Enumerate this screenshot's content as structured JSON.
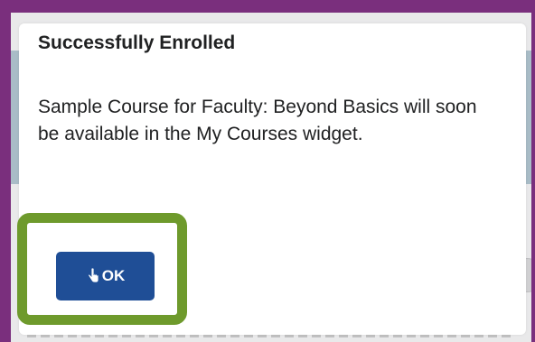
{
  "dialog": {
    "title": "Successfully Enrolled",
    "message": "Sample Course for Faculty: Beyond Basics will soon be available in the My Courses widget.",
    "ok_label": "OK"
  },
  "colors": {
    "frame": "#7a2f7d",
    "highlight": "#6e9a2c",
    "button": "#1f4e96"
  },
  "icons": {
    "cursor": "hand-pointer-icon"
  }
}
